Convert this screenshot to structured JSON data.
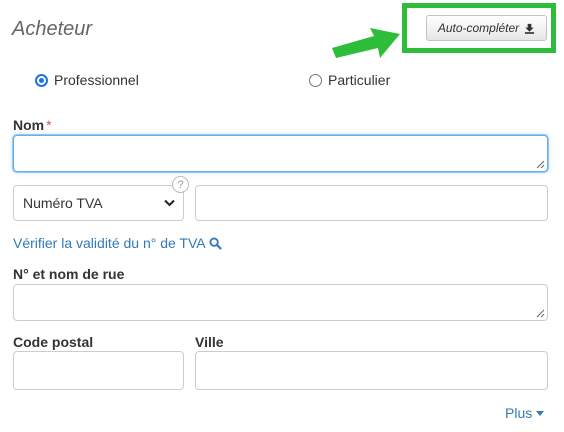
{
  "section": {
    "title": "Acheteur"
  },
  "autofill": {
    "label": "Auto-compléter",
    "icon": "download-icon",
    "highlight_color": "#2ebd3b"
  },
  "buyer_type": {
    "options": [
      {
        "label": "Professionnel",
        "checked": true
      },
      {
        "label": "Particulier",
        "checked": false
      }
    ]
  },
  "name": {
    "label": "Nom",
    "required_mark": "*",
    "value": ""
  },
  "tax_id": {
    "select_value": "Numéro TVA",
    "help": "?",
    "value": ""
  },
  "verify": {
    "label": "Vérifier la validité du n° de TVA",
    "icon": "search-icon"
  },
  "street": {
    "label": "N° et nom de rue",
    "value": ""
  },
  "postal": {
    "label": "Code postal",
    "value": ""
  },
  "city": {
    "label": "Ville",
    "value": ""
  },
  "more": {
    "label": "Plus",
    "icon": "caret-down-icon"
  },
  "colors": {
    "accent": "#337ab7",
    "focus": "#66afe9",
    "required": "#d9534f"
  }
}
